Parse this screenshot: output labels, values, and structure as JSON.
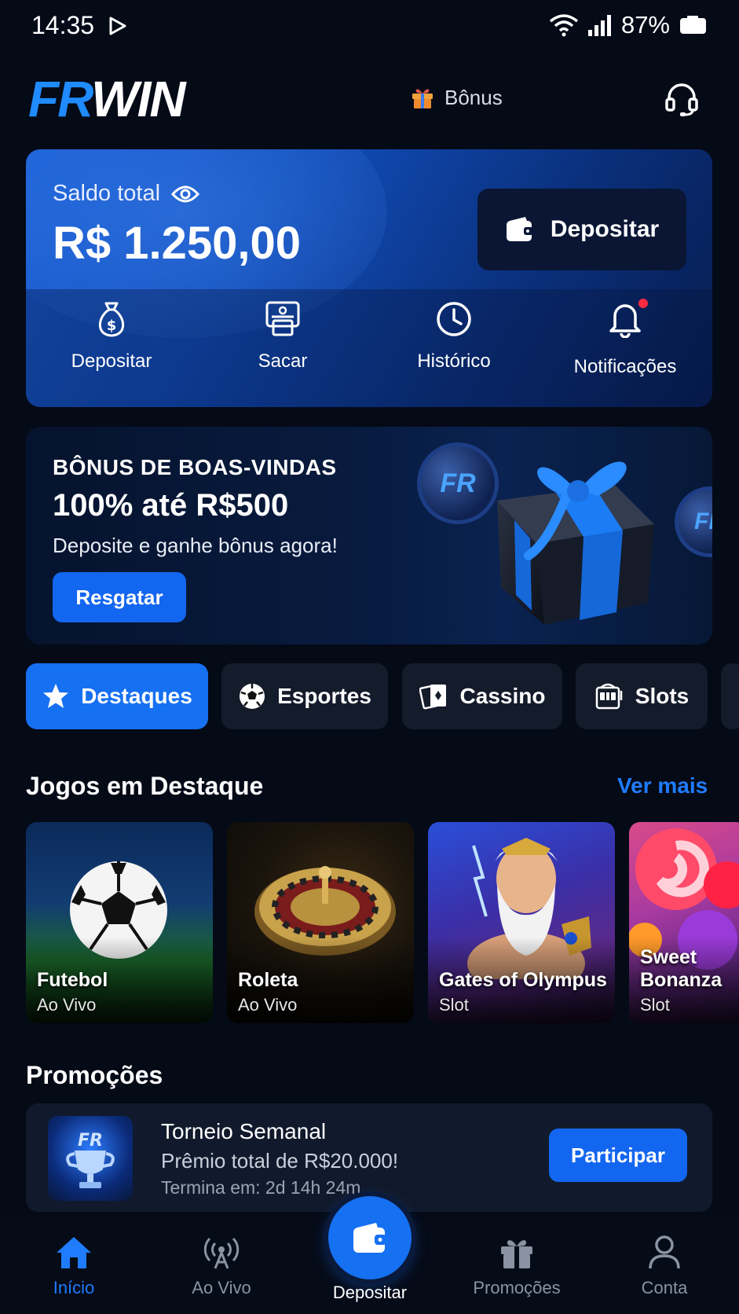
{
  "status_bar": {
    "time": "14:35",
    "battery": "87%"
  },
  "header": {
    "logo_fr": "FR",
    "logo_win": "WIN",
    "bonus_label": "Bônus"
  },
  "balance": {
    "label": "Saldo total",
    "amount": "R$ 1.250,00",
    "deposit_button": "Depositar",
    "quick_actions": [
      {
        "label": "Depositar",
        "icon": "money-bag-icon"
      },
      {
        "label": "Sacar",
        "icon": "atm-icon"
      },
      {
        "label": "Histórico",
        "icon": "clock-icon"
      },
      {
        "label": "Notificações",
        "icon": "bell-icon"
      }
    ]
  },
  "welcome_promo": {
    "title": "BÔNUS DE BOAS-VINDAS",
    "amount": "100% até R$500",
    "subtitle": "Deposite e ganhe bônus agora!",
    "button": "Resgatar",
    "coin_text": "FR"
  },
  "categories": [
    {
      "label": "Destaques",
      "icon": "star-icon",
      "active": true
    },
    {
      "label": "Esportes",
      "icon": "soccer-ball-icon",
      "active": false
    },
    {
      "label": "Cassino",
      "icon": "cards-icon",
      "active": false
    },
    {
      "label": "Slots",
      "icon": "slot-machine-icon",
      "active": false
    }
  ],
  "featured": {
    "title": "Jogos em Destaque",
    "see_more": "Ver mais",
    "games": [
      {
        "name": "Futebol",
        "kind": "Ao Vivo"
      },
      {
        "name": "Roleta",
        "kind": "Ao Vivo"
      },
      {
        "name": "Gates of Olympus",
        "kind": "Slot"
      },
      {
        "name": "Sweet Bonanza",
        "kind": "Slot"
      }
    ]
  },
  "promotions": {
    "title": "Promoções",
    "card": {
      "title": "Torneio Semanal",
      "subtitle": "Prêmio total de R$20.000!",
      "ends": "Termina em: 2d 14h 24m",
      "button": "Participar",
      "badge": "FR"
    }
  },
  "bottom_nav": [
    {
      "label": "Início",
      "icon": "home-icon",
      "active": true
    },
    {
      "label": "Ao Vivo",
      "icon": "broadcast-icon",
      "active": false
    },
    {
      "label": "Depositar",
      "icon": "wallet-icon",
      "active": false
    },
    {
      "label": "Promoções",
      "icon": "gift-icon",
      "active": false
    },
    {
      "label": "Conta",
      "icon": "user-icon",
      "active": false
    }
  ],
  "colors": {
    "accent": "#1670f2",
    "background": "#050a17",
    "notification": "#ff2b43"
  }
}
